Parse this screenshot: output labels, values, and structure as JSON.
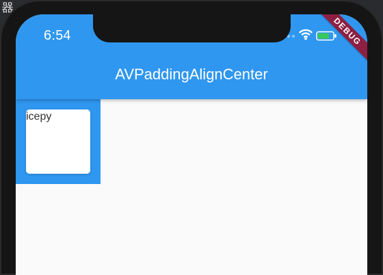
{
  "desktop": {
    "background_color": "#2a2b2f",
    "top_left_glyph": "器"
  },
  "device": {
    "frame_color": "#151515",
    "screen_color": "#fafafa"
  },
  "status_bar": {
    "time": "6:54",
    "icons": [
      "signal-dots-icon",
      "wifi-icon",
      "battery-icon"
    ]
  },
  "debug_banner": {
    "label": "DEBUG",
    "color": "#8d1f42"
  },
  "app_bar": {
    "title": "AVPaddingAlignCenter",
    "color": "#2f97f0"
  },
  "main": {
    "container_color": "#2f97f0",
    "card": {
      "text": "icepy",
      "background_color": "#ffffff"
    }
  }
}
